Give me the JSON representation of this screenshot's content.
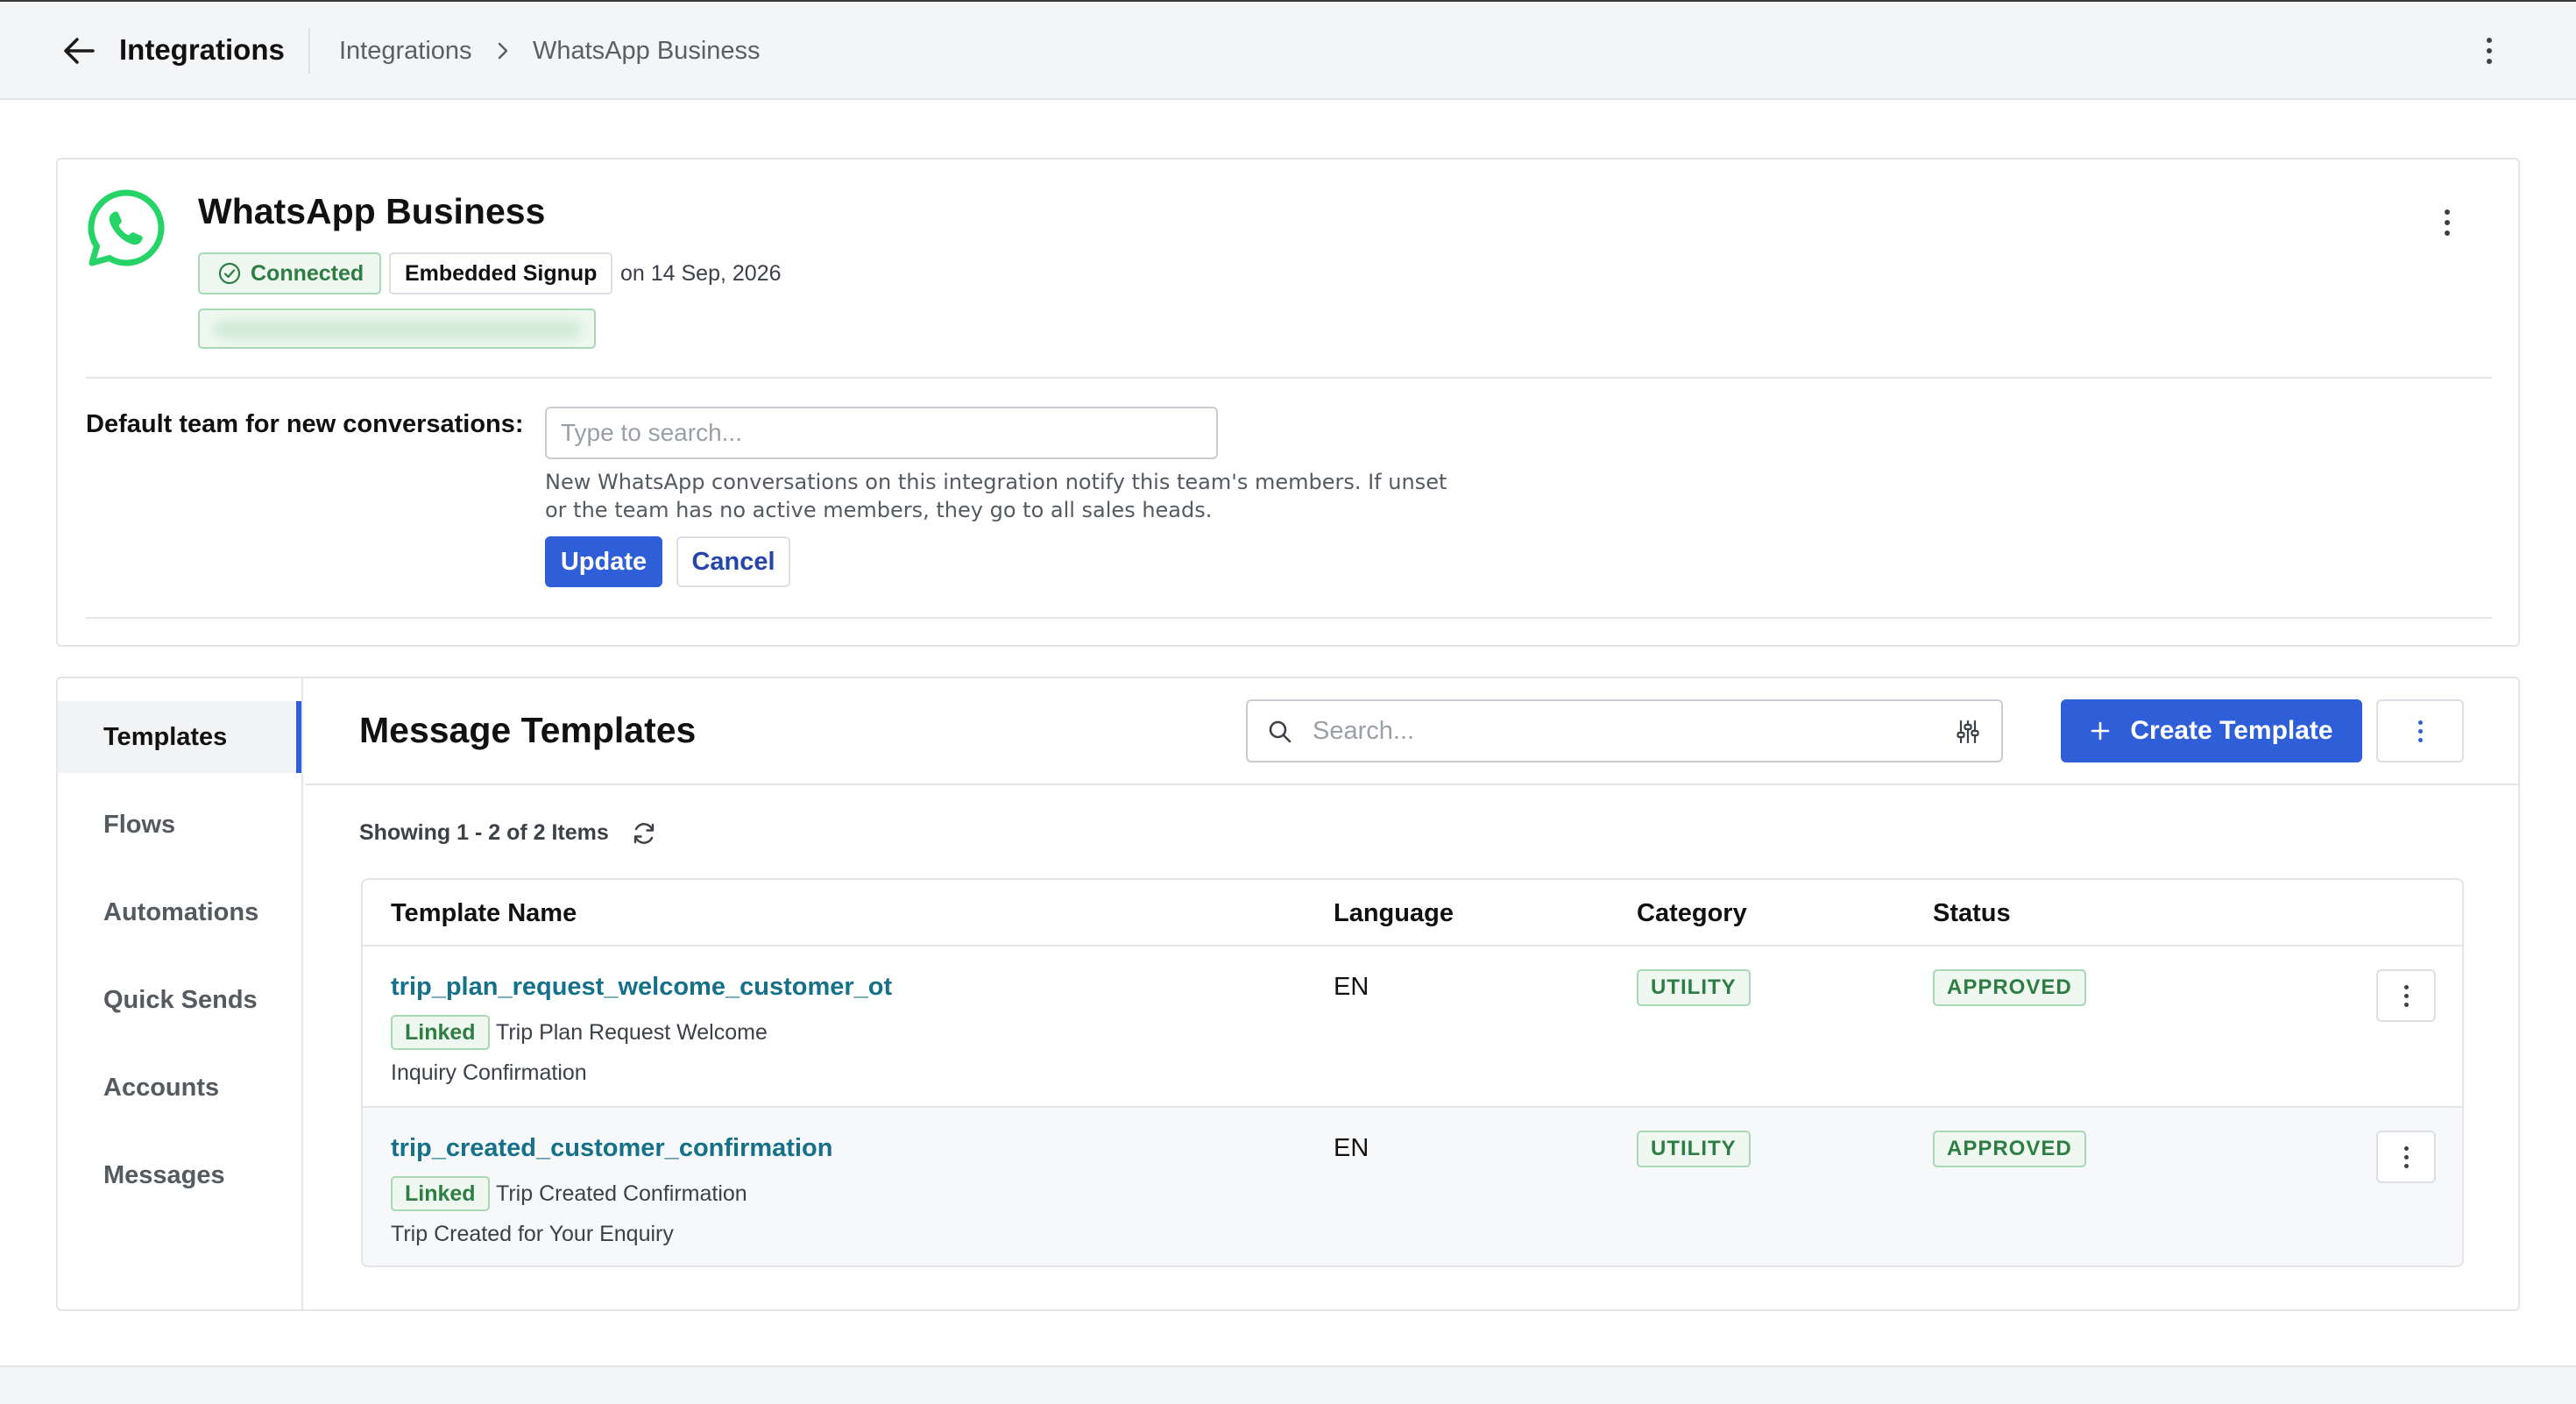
{
  "topbar": {
    "title": "Integrations",
    "breadcrumb": [
      "Integrations",
      "WhatsApp Business"
    ]
  },
  "integration": {
    "name": "WhatsApp Business",
    "status": "Connected",
    "signup_type": "Embedded Signup",
    "signup_date": "on 14 Sep, 2026",
    "default_team": {
      "label": "Default team for new conversations:",
      "placeholder": "Type to search...",
      "help": "New WhatsApp conversations on this integration notify this team's members. If unset or the team has no active members, they go to all sales heads.",
      "update_label": "Update",
      "cancel_label": "Cancel"
    }
  },
  "sidebar": {
    "items": [
      {
        "label": "Templates",
        "active": true
      },
      {
        "label": "Flows"
      },
      {
        "label": "Automations"
      },
      {
        "label": "Quick Sends"
      },
      {
        "label": "Accounts"
      },
      {
        "label": "Messages"
      }
    ]
  },
  "templates": {
    "title": "Message Templates",
    "search_placeholder": "Search...",
    "create_label": "Create Template",
    "showing": "Showing 1 - 2 of 2 Items",
    "columns": [
      "Template Name",
      "Language",
      "Category",
      "Status"
    ],
    "rows": [
      {
        "name": "trip_plan_request_welcome_customer_ot",
        "linked_label": "Linked",
        "linked_desc_1": "Trip Plan Request Welcome",
        "linked_desc_2": "Inquiry Confirmation",
        "language": "EN",
        "category": "UTILITY",
        "status": "APPROVED"
      },
      {
        "name": "trip_created_customer_confirmation",
        "linked_label": "Linked",
        "linked_desc_1": "Trip Created Confirmation",
        "linked_desc_2": "Trip Created for Your Enquiry",
        "language": "EN",
        "category": "UTILITY",
        "status": "APPROVED"
      }
    ]
  },
  "icons": {
    "back": "arrow-left-icon",
    "breadcrumb_sep": "chevron-right-icon",
    "logo": "whatsapp-logo-icon",
    "connected": "check-circle-icon",
    "search": "search-icon",
    "filter": "sliders-icon",
    "create": "plus-icon",
    "refresh": "refresh-icon",
    "menu": "kebab-icon"
  },
  "colors": {
    "primary": "#2f5fd8",
    "success": "#2e7d43",
    "success_bg": "#eef8f0",
    "link": "#15708a",
    "whatsapp": "#25d366"
  }
}
